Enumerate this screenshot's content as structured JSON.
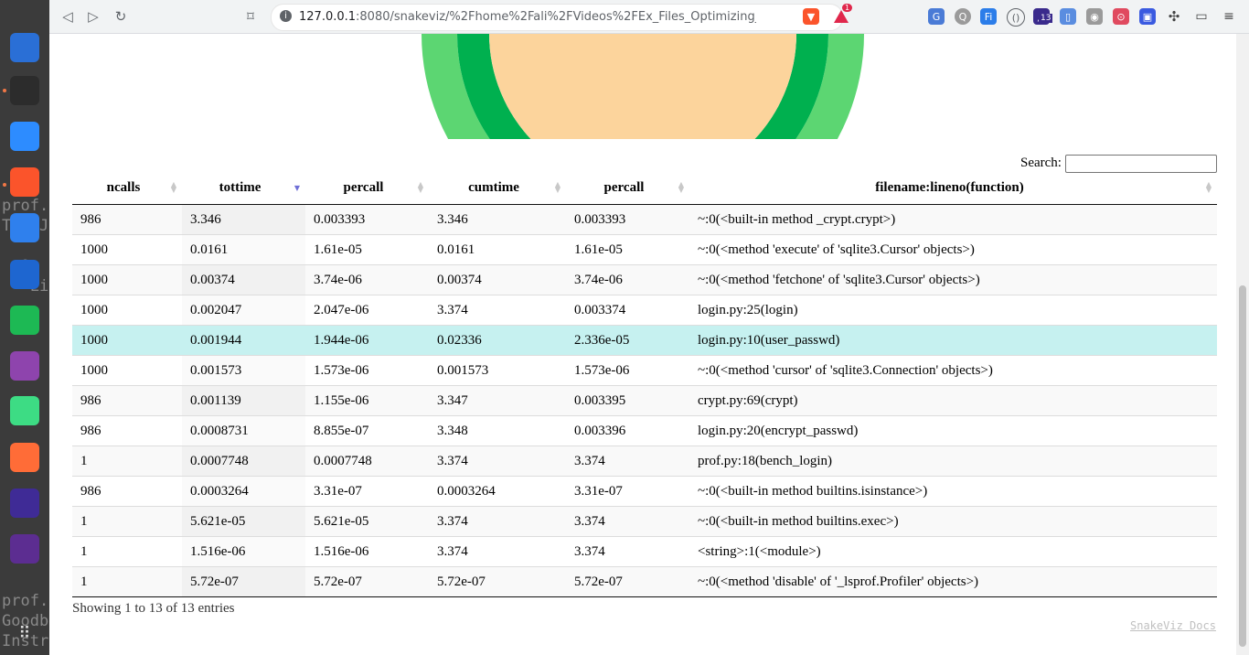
{
  "dock": {
    "terminal_text": [
      "prof.",
      "Thu J",
      "",
      "  Or",
      "   Li",
      "",
      "  nc",
      "",
      "",
      "",
      "",
      "",
      "",
      "",
      "",
      "prof.",
      "Goodb",
      "Instr"
    ],
    "apps": [
      {
        "icon": "text-editor-icon",
        "color": "#2a6fd6"
      },
      {
        "icon": "terminal-icon",
        "color": "#2c2c2c"
      },
      {
        "icon": "zoom-icon",
        "color": "#2d8cff"
      },
      {
        "icon": "brave-browser-icon",
        "color": "#fb542b"
      },
      {
        "icon": "vscode-icon",
        "color": "#2f80ed"
      },
      {
        "icon": "timer-icon",
        "color": "#1e66d0"
      },
      {
        "icon": "spotify-icon",
        "color": "#1db954"
      },
      {
        "icon": "video-editor-icon",
        "color": "#8e44ad"
      },
      {
        "icon": "android-studio-icon",
        "color": "#3ddc84"
      },
      {
        "icon": "postman-icon",
        "color": "#ff6c37"
      },
      {
        "icon": "screen-recorder-icon",
        "color": "#3f2b96"
      },
      {
        "icon": "media-player-icon",
        "color": "#5c2d91"
      }
    ]
  },
  "browser": {
    "url_host": "127.0.0.1",
    "url_rest": ":8080/snakeviz/%2Fhome%2Fali%2FVideos%2FEx_Files_Optimizing_Python_Cod...",
    "brave_badge": "1",
    "ext_badge": "13"
  },
  "search": {
    "label": "Search:",
    "value": ""
  },
  "table": {
    "headers": [
      "ncalls",
      "tottime",
      "percall",
      "cumtime",
      "percall",
      "filename:lineno(function)"
    ],
    "sorted_column": "tottime",
    "rows": [
      [
        "986",
        "3.346",
        "0.003393",
        "3.346",
        "0.003393",
        "~:0(<built-in method _crypt.crypt>)"
      ],
      [
        "1000",
        "0.0161",
        "1.61e-05",
        "0.0161",
        "1.61e-05",
        "~:0(<method 'execute' of 'sqlite3.Cursor' objects>)"
      ],
      [
        "1000",
        "0.00374",
        "3.74e-06",
        "0.00374",
        "3.74e-06",
        "~:0(<method 'fetchone' of 'sqlite3.Cursor' objects>)"
      ],
      [
        "1000",
        "0.002047",
        "2.047e-06",
        "3.374",
        "0.003374",
        "login.py:25(login)"
      ],
      [
        "1000",
        "0.001944",
        "1.944e-06",
        "0.02336",
        "2.336e-05",
        "login.py:10(user_passwd)"
      ],
      [
        "1000",
        "0.001573",
        "1.573e-06",
        "0.001573",
        "1.573e-06",
        "~:0(<method 'cursor' of 'sqlite3.Connection' objects>)"
      ],
      [
        "986",
        "0.001139",
        "1.155e-06",
        "3.347",
        "0.003395",
        "crypt.py:69(crypt)"
      ],
      [
        "986",
        "0.0008731",
        "8.855e-07",
        "3.348",
        "0.003396",
        "login.py:20(encrypt_passwd)"
      ],
      [
        "1",
        "0.0007748",
        "0.0007748",
        "3.374",
        "3.374",
        "prof.py:18(bench_login)"
      ],
      [
        "986",
        "0.0003264",
        "3.31e-07",
        "0.0003264",
        "3.31e-07",
        "~:0(<built-in method builtins.isinstance>)"
      ],
      [
        "1",
        "5.621e-05",
        "5.621e-05",
        "3.374",
        "3.374",
        "~:0(<built-in method builtins.exec>)"
      ],
      [
        "1",
        "1.516e-06",
        "1.516e-06",
        "3.374",
        "3.374",
        "<string>:1(<module>)"
      ],
      [
        "1",
        "5.72e-07",
        "5.72e-07",
        "5.72e-07",
        "5.72e-07",
        "~:0(<method 'disable' of '_lsprof.Profiler' objects>)"
      ]
    ],
    "highlighted_row": 4
  },
  "info": "Showing 1 to 13 of 13 entries",
  "docs_link": "SnakeViz Docs",
  "colors": {
    "ring_outer": "#5cd672",
    "ring_mid": "#00b04f",
    "center": "#fcd49c",
    "highlight": "#c6f1f0"
  }
}
